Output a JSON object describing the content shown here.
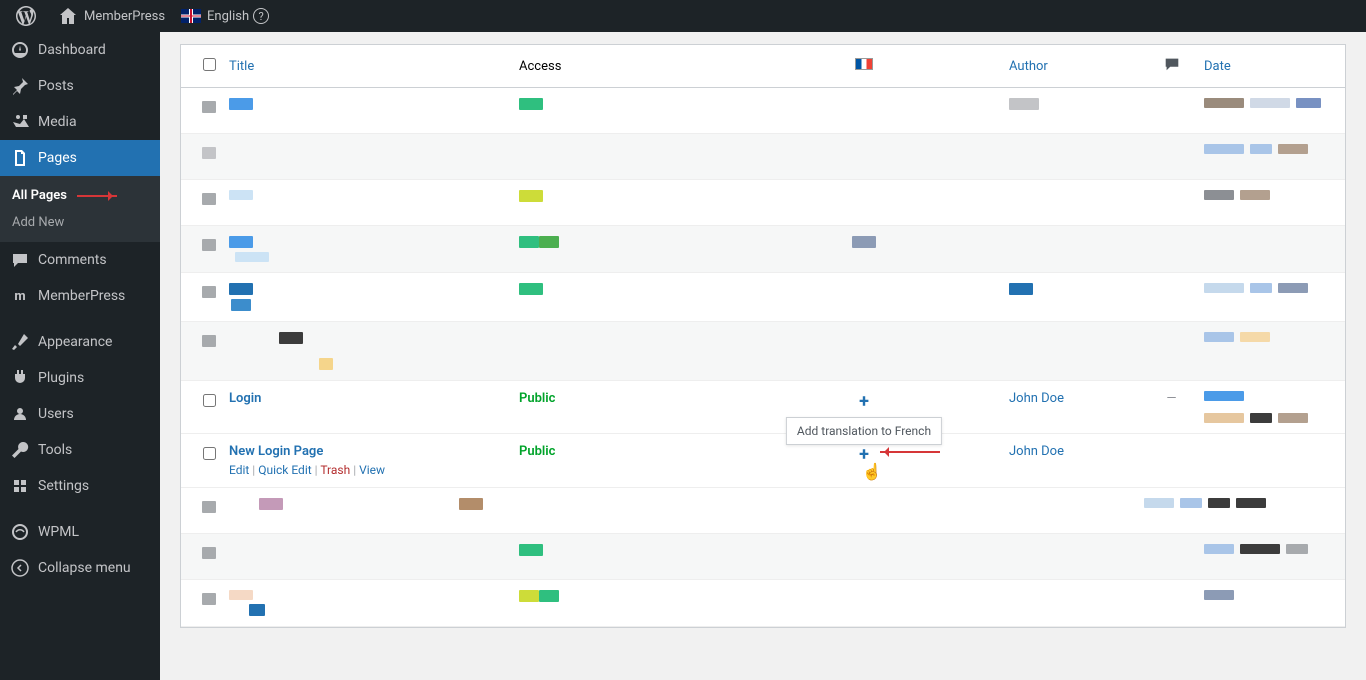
{
  "topbar": {
    "site_name": "MemberPress",
    "language": "English"
  },
  "sidebar": {
    "dashboard": "Dashboard",
    "posts": "Posts",
    "media": "Media",
    "pages": "Pages",
    "all_pages": "All Pages",
    "add_new": "Add New",
    "comments": "Comments",
    "memberpress": "MemberPress",
    "appearance": "Appearance",
    "plugins": "Plugins",
    "users": "Users",
    "tools": "Tools",
    "settings": "Settings",
    "wpml": "WPML",
    "collapse": "Collapse menu"
  },
  "table": {
    "headers": {
      "title": "Title",
      "access": "Access",
      "author": "Author",
      "date": "Date"
    },
    "login_row": {
      "title": "Login",
      "access": "Public",
      "author": "John Doe",
      "comment_dash": "—"
    },
    "new_login_row": {
      "title": "New Login Page",
      "access": "Public",
      "author": "John Doe",
      "actions": {
        "edit": "Edit",
        "quick_edit": "Quick Edit",
        "trash": "Trash",
        "view": "View"
      }
    }
  },
  "tooltip": "Add translation to French",
  "colors": {
    "primary": "#2271b1",
    "green": "#00a32a"
  }
}
